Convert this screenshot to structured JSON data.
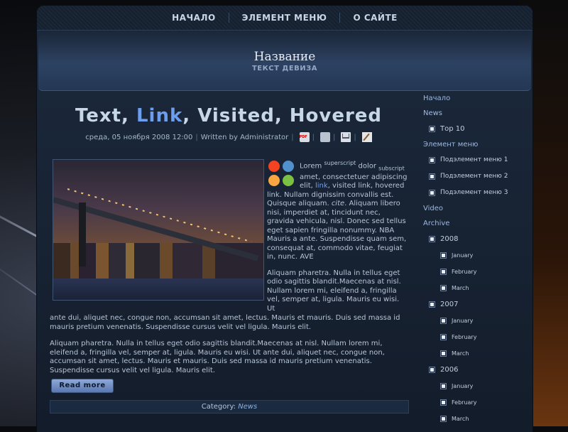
{
  "topnav": {
    "items": [
      "НАЧАЛО",
      "ЭЛЕМЕНТ МЕНЮ",
      "О САЙТЕ"
    ]
  },
  "header": {
    "title": "Название",
    "motto": "ТЕКСТ ДЕВИЗА"
  },
  "article": {
    "title_part1": "Text, ",
    "title_link": "Link",
    "title_part2": ", Visited, Hovered",
    "date": "среда, 05 ноября 2008 12:00",
    "author": "Written by Administrator",
    "intro": {
      "t1": "Lorem ",
      "sup": "superscript",
      "t2": " dolor ",
      "sub": "subscript",
      "t3": " amet, consectetuer adipiscing elit, ",
      "link": "link",
      "t4": ", visited link, hovered link. Nullam dignissim convallis est. Quisque aliquam. ",
      "cite": "cite",
      "t5": ". Aliquam libero nisi, imperdiet at, tincidunt nec, gravida vehicula, nisl. Donec sed tellus eget sapien fringilla nonummy. NBA Mauris a ante. Suspendisse quam sem, consequat at, commodo vitae, feugiat in, nunc. AVE"
    },
    "para2_right": "Aliquam pharetra. Nulla in tellus eget odio sagittis blandit.Maecenas at nisl. Nullam lorem mi, eleifend a, fringilla vel, semper at, ligula. Mauris eu wisi. Ut",
    "para2_full": "ante dui, aliquet nec, congue non, accumsan sit amet, lectus. Mauris et mauris. Duis sed massa id mauris pretium venenatis. Suspendisse cursus velit vel ligula. Mauris elit.",
    "para3": "Aliquam pharetra. Nulla in tellus eget odio sagittis blandit.Maecenas at nisl. Nullam lorem mi, eleifend a, fringilla vel, semper at, ligula. Mauris eu wisi. Ut ante dui, aliquet nec, congue non, accumsan sit amet, lectus. Mauris et mauris. Duis sed massa id mauris pretium venenatis. Suspendisse cursus velit vel ligula. Mauris elit.",
    "read_more": "Read more",
    "category_label": "Category: ",
    "category_value": "News"
  },
  "sidebar": {
    "home": "Начало",
    "news": "News",
    "top10": "Тоp 10",
    "menu_item": "Элемент меню",
    "sub1": "Подэлемент меню 1",
    "sub2": "Подэлемент меню 2",
    "sub3": "Подэлемент меню 3",
    "video": "Video",
    "archive": "Archive",
    "years": [
      {
        "year": "2008",
        "months": [
          "January",
          "February",
          "March"
        ]
      },
      {
        "year": "2007",
        "months": [
          "January",
          "February",
          "March"
        ]
      },
      {
        "year": "2006",
        "months": [
          "January",
          "February",
          "March"
        ]
      }
    ]
  },
  "colors": {
    "link": "#6c9ef0",
    "frame": "#1c2a3d",
    "header": "#2d4262"
  },
  "icons": [
    "pdf-icon",
    "print-icon",
    "email-icon",
    "edit-icon",
    "joomla-logo-icon"
  ]
}
